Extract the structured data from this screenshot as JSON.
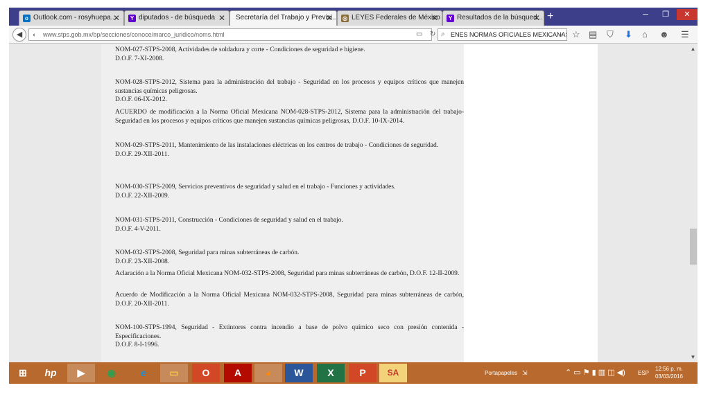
{
  "tabs": [
    {
      "label": "Outlook.com - rosyhuepa...",
      "icon": "outlook-icon",
      "color": "#0072c6"
    },
    {
      "label": "diputados - de búsqueda",
      "icon": "yahoo-icon",
      "color": "#6001d2"
    },
    {
      "label": "Secretaría del Trabajo y Previsi...",
      "icon": "page-icon",
      "color": "#999999"
    },
    {
      "label": "LEYES Federales de México",
      "icon": "seal-icon",
      "color": "#8a6d3b"
    },
    {
      "label": "Resultados de la búsqued...",
      "icon": "yahoo-icon",
      "color": "#6001d2"
    }
  ],
  "newtab_label": "+",
  "window_controls": {
    "minimize": "─",
    "maximize": "❐",
    "close": "✕"
  },
  "address_bar": {
    "url": "www.stps.gob.mx/bp/secciones/conoce/marco_juridico/noms.html"
  },
  "search_bar": {
    "value": "ENES NORMAS OFICIALES MEXICANAS"
  },
  "entries": [
    {
      "lines": [
        "NOM-027-STPS-2008, Actividades de soldadura y corte - Condiciones de seguridad e higiene.",
        "D.O.F. 7-XI-2008."
      ]
    },
    {
      "lines": [
        "NOM-028-STPS-2012, Sistema para la administración del trabajo - Seguridad en los procesos y equipos críticos que manejen sustancias químicas peligrosas.",
        "D.O.F. 06-IX-2012."
      ]
    },
    {
      "lines": [
        "ACUERDO de modificación a la Norma Oficial Mexicana NOM-028-STPS-2012, Sistema para la administración del trabajo-Seguridad en los procesos y equipos críticos que manejen sustancias químicas peligrosas, D.O.F. 10-IX-2014."
      ]
    },
    {
      "lines": [
        "NOM-029-STPS-2011, Mantenimiento de las instalaciones eléctricas en los centros de trabajo - Condiciones de seguridad.",
        "D.O.F. 29-XII-2011."
      ]
    },
    {
      "lines": [
        "NOM-030-STPS-2009, Servicios preventivos de seguridad y salud en el trabajo - Funciones y actividades.",
        "D.O.F. 22-XII-2009."
      ]
    },
    {
      "lines": [
        "NOM-031-STPS-2011, Construcción - Condiciones de seguridad y salud en el trabajo.",
        "D.O.F. 4-V-2011."
      ]
    },
    {
      "lines": [
        "NOM-032-STPS-2008, Seguridad para minas subterráneas de carbón.",
        "D.O.F. 23-XII-2008."
      ]
    },
    {
      "lines": [
        "Aclaración a la Norma Oficial Mexicana NOM-032-STPS-2008, Seguridad para minas subterráneas de carbón, D.O.F. 12-II-2009."
      ]
    },
    {
      "lines": [
        "Acuerdo de Modificación a la Norma Oficial Mexicana NOM-032-STPS-2008, Seguridad para minas subterráneas de carbón, D.O.F. 20-XII-2011."
      ]
    },
    {
      "lines": [
        "NOM-100-STPS-1994, Seguridad - Extintores contra incendio a base de polvo químico seco con presión contenida - Especificaciones.",
        "D.O.F. 8-I-1996."
      ]
    }
  ],
  "taskbar": {
    "apps": [
      {
        "name": "start-button",
        "glyph": "⊞",
        "color": "#ffffff"
      },
      {
        "name": "hp-icon",
        "glyph": "hp",
        "color": "#ffffff"
      },
      {
        "name": "media-player-icon",
        "glyph": "▶",
        "color": "#ffffff"
      },
      {
        "name": "chrome-icon",
        "glyph": "◉",
        "color": "#2e9e4f"
      },
      {
        "name": "ie-icon",
        "glyph": "e",
        "color": "#1c8fd6"
      },
      {
        "name": "file-explorer-icon",
        "glyph": "▭",
        "color": "#f1c44b"
      },
      {
        "name": "office-icon",
        "glyph": "O",
        "color": "#ffffff"
      },
      {
        "name": "acrobat-icon",
        "glyph": "A",
        "color": "#ffffff"
      },
      {
        "name": "firefox-icon",
        "glyph": "◕",
        "color": "#ff8a00"
      },
      {
        "name": "word-icon",
        "glyph": "W",
        "color": "#ffffff"
      },
      {
        "name": "excel-icon",
        "glyph": "X",
        "color": "#ffffff"
      },
      {
        "name": "powerpoint-icon",
        "glyph": "P",
        "color": "#ffffff"
      },
      {
        "name": "sa-app-icon",
        "glyph": "SA",
        "color": "#c0392b"
      }
    ],
    "tray_label": "Portapapeles",
    "language": "ESP",
    "time": "12:56 p. m.",
    "date": "03/03/2016"
  }
}
